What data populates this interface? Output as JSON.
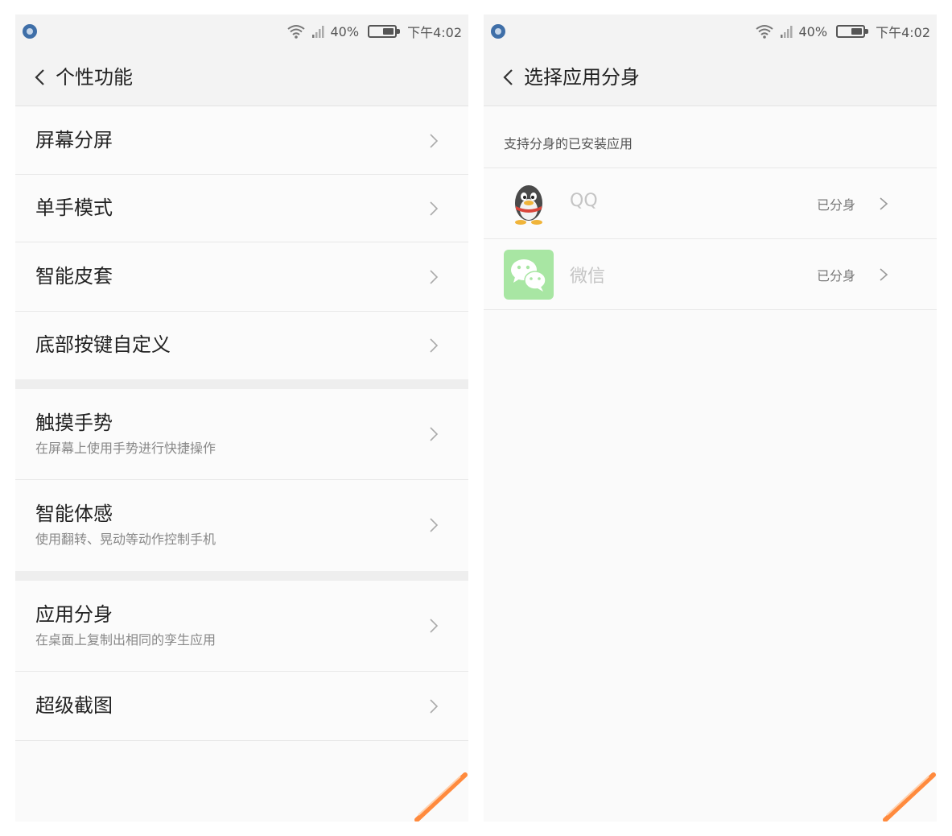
{
  "left_screen": {
    "status_bar": {
      "battery": "40%",
      "time": "下午4:02"
    },
    "nav_title": "个性功能",
    "items": [
      {
        "title": "屏幕分屏"
      },
      {
        "title": "单手模式"
      },
      {
        "title": "智能皮套"
      },
      {
        "title": "底部按键自定义"
      },
      {
        "title": "触摸手势",
        "subtitle": "在屏幕上使用手势进行快捷操作"
      },
      {
        "title": "智能体感",
        "subtitle": "使用翻转、晃动等动作控制手机"
      },
      {
        "title": "应用分身",
        "subtitle": "在桌面上复制出相同的孪生应用"
      },
      {
        "title": "超级截图"
      }
    ]
  },
  "right_screen": {
    "status_bar": {
      "battery": "40%",
      "time": "下午4:02"
    },
    "nav_title": "选择应用分身",
    "section_label": "支持分身的已安装应用",
    "apps": [
      {
        "name": "QQ",
        "status": "已分身",
        "icon": "qq-penguin-icon"
      },
      {
        "name": "微信",
        "status": "已分身",
        "icon": "wechat-icon",
        "icon_color": "#56c25c"
      }
    ]
  }
}
